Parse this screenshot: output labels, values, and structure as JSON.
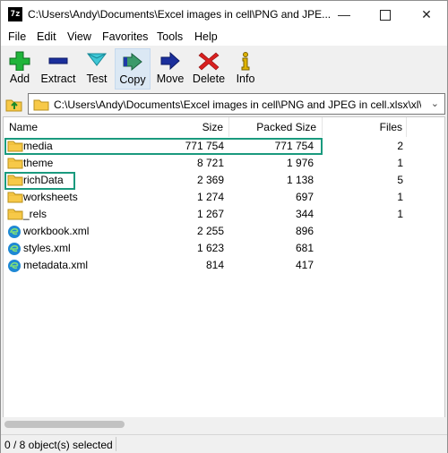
{
  "window": {
    "title": "C:\\Users\\Andy\\Documents\\Excel images in cell\\PNG and JPE...",
    "app_icon_text": "7z"
  },
  "menu": [
    "File",
    "Edit",
    "View",
    "Favorites",
    "Tools",
    "Help"
  ],
  "toolbar": {
    "add": "Add",
    "extract": "Extract",
    "test": "Test",
    "copy": "Copy",
    "move": "Move",
    "delete": "Delete",
    "info": "Info"
  },
  "address": {
    "path": "C:\\Users\\Andy\\Documents\\Excel images in cell\\PNG and JPEG in cell.xlsx\\xl\\"
  },
  "columns": {
    "name": "Name",
    "size": "Size",
    "packed": "Packed Size",
    "files": "Files"
  },
  "rows": [
    {
      "name": "media",
      "size": "771 754",
      "packed": "771 754",
      "files": "2",
      "type": "folder"
    },
    {
      "name": "theme",
      "size": "8 721",
      "packed": "1 976",
      "files": "1",
      "type": "folder"
    },
    {
      "name": "richData",
      "size": "2 369",
      "packed": "1 138",
      "files": "5",
      "type": "folder"
    },
    {
      "name": "worksheets",
      "size": "1 274",
      "packed": "697",
      "files": "1",
      "type": "folder"
    },
    {
      "name": "_rels",
      "size": "1 267",
      "packed": "344",
      "files": "1",
      "type": "folder"
    },
    {
      "name": "workbook.xml",
      "size": "2 255",
      "packed": "896",
      "files": "",
      "type": "xml"
    },
    {
      "name": "styles.xml",
      "size": "1 623",
      "packed": "681",
      "files": "",
      "type": "xml"
    },
    {
      "name": "metadata.xml",
      "size": "814",
      "packed": "417",
      "files": "",
      "type": "xml"
    }
  ],
  "status": {
    "text": "0 / 8 object(s) selected"
  },
  "colors": {
    "highlight": "#1a9a7e",
    "folder": "#f7c948",
    "edge_icon": "#1e88d4"
  }
}
